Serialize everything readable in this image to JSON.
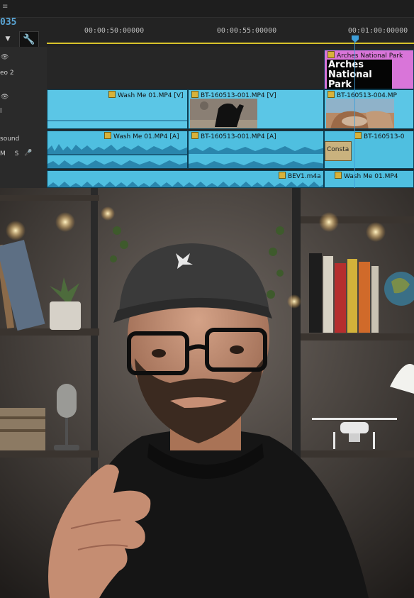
{
  "editor": {
    "menu_icon": "hamburger-menu-icon",
    "sequence_timecode": "035",
    "ruler_labels": [
      "00:00:50:00000",
      "00:00:55:00000",
      "00:01:00:00000"
    ],
    "tracks": {
      "v2_name": "eo 2",
      "v1_name": "l",
      "a1_name": "sound",
      "a1_controls": "M S"
    },
    "clips": {
      "v2_graphic": "Arches National Park",
      "v2_graphic_text": [
        "Arches",
        "National",
        "Park"
      ],
      "v1_clip1": "Wash Me 01.MP4 [V]",
      "v1_clip2": "BT-160513-001.MP4 [V]",
      "v1_clip3": "BT-160513-004.MP",
      "a1_clip1": "Wash Me 01.MP4 [A]",
      "a1_clip2": "BT-160513-001.MP4 [A]",
      "a1_clip3": "BT-160513-0",
      "a1_clip4": "Consta",
      "a2_clip1": "BEV1.m4a",
      "a2_clip2": "Wash Me 01.MP4"
    },
    "colors": {
      "video_clip": "#5bc6e6",
      "graphic_clip": "#d975d9",
      "audio_clip": "#4fbfe0",
      "playhead": "#3d9ed9",
      "work_area": "#d8c22a"
    }
  },
  "webcam": {
    "cap_logo": "logo on cap"
  }
}
